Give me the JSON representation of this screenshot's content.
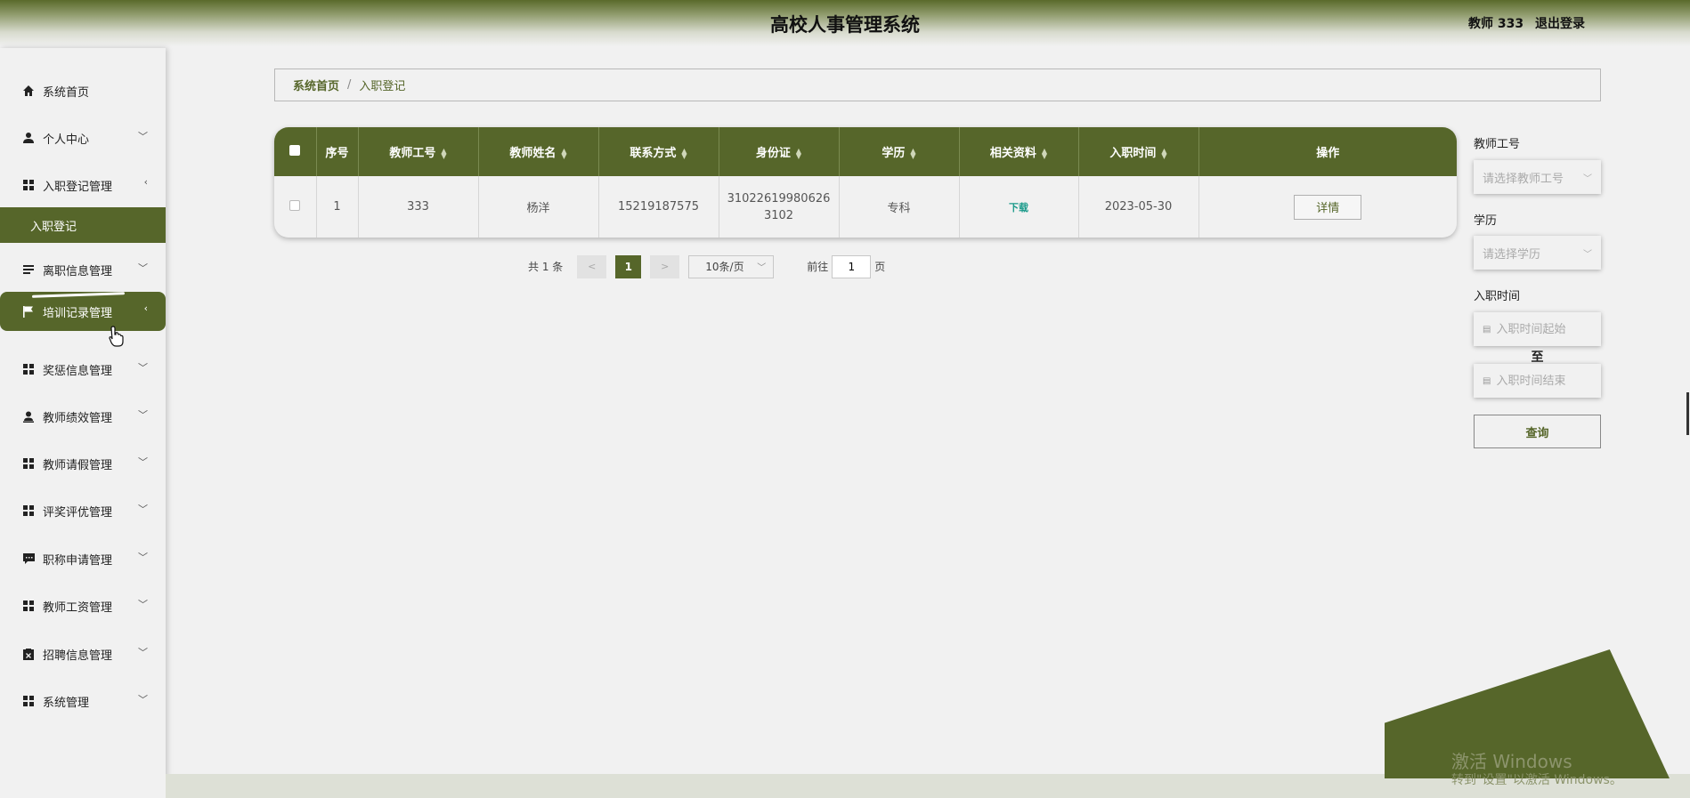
{
  "header": {
    "title": "高校人事管理系统",
    "user": "教师 333",
    "logout": "退出登录"
  },
  "sidebar": {
    "items": [
      {
        "label": "系统首页",
        "icon": "home-icon"
      },
      {
        "label": "个人中心",
        "icon": "user-icon"
      },
      {
        "label": "入职登记管理",
        "icon": "grid-icon"
      },
      {
        "label": "入职登记",
        "icon": ""
      },
      {
        "label": "离职信息管理",
        "icon": "list-icon"
      },
      {
        "label": "培训记录管理",
        "icon": "flag-icon"
      },
      {
        "label": "奖惩信息管理",
        "icon": "grid-icon"
      },
      {
        "label": "教师绩效管理",
        "icon": "person-icon"
      },
      {
        "label": "教师请假管理",
        "icon": "grid-icon"
      },
      {
        "label": "评奖评优管理",
        "icon": "grid-icon"
      },
      {
        "label": "职称申请管理",
        "icon": "chat-icon"
      },
      {
        "label": "教师工资管理",
        "icon": "grid-icon"
      },
      {
        "label": "招聘信息管理",
        "icon": "clipboard-icon"
      },
      {
        "label": "系统管理",
        "icon": "grid-icon"
      }
    ]
  },
  "breadcrumb": {
    "home": "系统首页",
    "separator": "/",
    "current": "入职登记"
  },
  "table": {
    "columns": [
      "序号",
      "教师工号",
      "教师姓名",
      "联系方式",
      "身份证",
      "学历",
      "相关资料",
      "入职时间",
      "操作"
    ],
    "rows": [
      {
        "index": "1",
        "teacher_id": "333",
        "name": "杨洋",
        "phone": "15219187575",
        "id_card_line1": "31022619980626",
        "id_card_line2": "3102",
        "education": "专科",
        "file": "下载",
        "date": "2023-05-30",
        "action": "详情"
      }
    ]
  },
  "pagination": {
    "total": "共 1 条",
    "prev": "<",
    "current": "1",
    "next": ">",
    "page_size": "10条/页",
    "goto_label": "前往",
    "goto_value": "1",
    "page_suffix": "页"
  },
  "filters": {
    "teacher_id_label": "教师工号",
    "teacher_id_placeholder": "请选择教师工号",
    "education_label": "学历",
    "education_placeholder": "请选择学历",
    "date_label": "入职时间",
    "date_start_placeholder": "入职时间起始",
    "date_to": "至",
    "date_end_placeholder": "入职时间结束",
    "query_button": "查询"
  },
  "watermark": {
    "line1": "激活 Windows",
    "line2": "转到\"设置\"以激活 Windows。"
  },
  "colors": {
    "accent": "#56662a",
    "link": "#1a9a8a"
  }
}
